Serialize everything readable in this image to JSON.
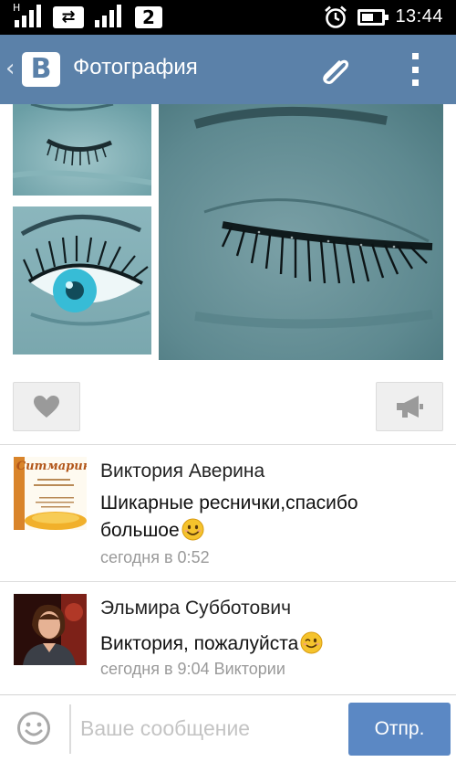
{
  "status_bar": {
    "network_type": "H",
    "sim_number": "2",
    "time": "13:44",
    "battery_level": 0.6
  },
  "header": {
    "logo_letter": "В",
    "title": "Фотография"
  },
  "actions": {
    "like_icon": "heart-icon",
    "share_icon": "megaphone-icon"
  },
  "comments": [
    {
      "author": "Виктория Аверина",
      "text": "Шикарные реснички,спасибо большое",
      "emoji": "smiling-emoji",
      "date": "сегодня в 0:52",
      "avatar_text": "Ситмарин"
    },
    {
      "author": "Эльмира Субботович",
      "text": "Виктория, пожалуйста",
      "emoji": "winking-emoji",
      "date": "сегодня в 9:04 Виктории"
    }
  ],
  "composer": {
    "placeholder": "Ваше сообщение",
    "send_label": "Отпр."
  },
  "colors": {
    "header": "#5b81a9",
    "send_button": "#5b88c4",
    "date_text": "#9a9a9a"
  }
}
